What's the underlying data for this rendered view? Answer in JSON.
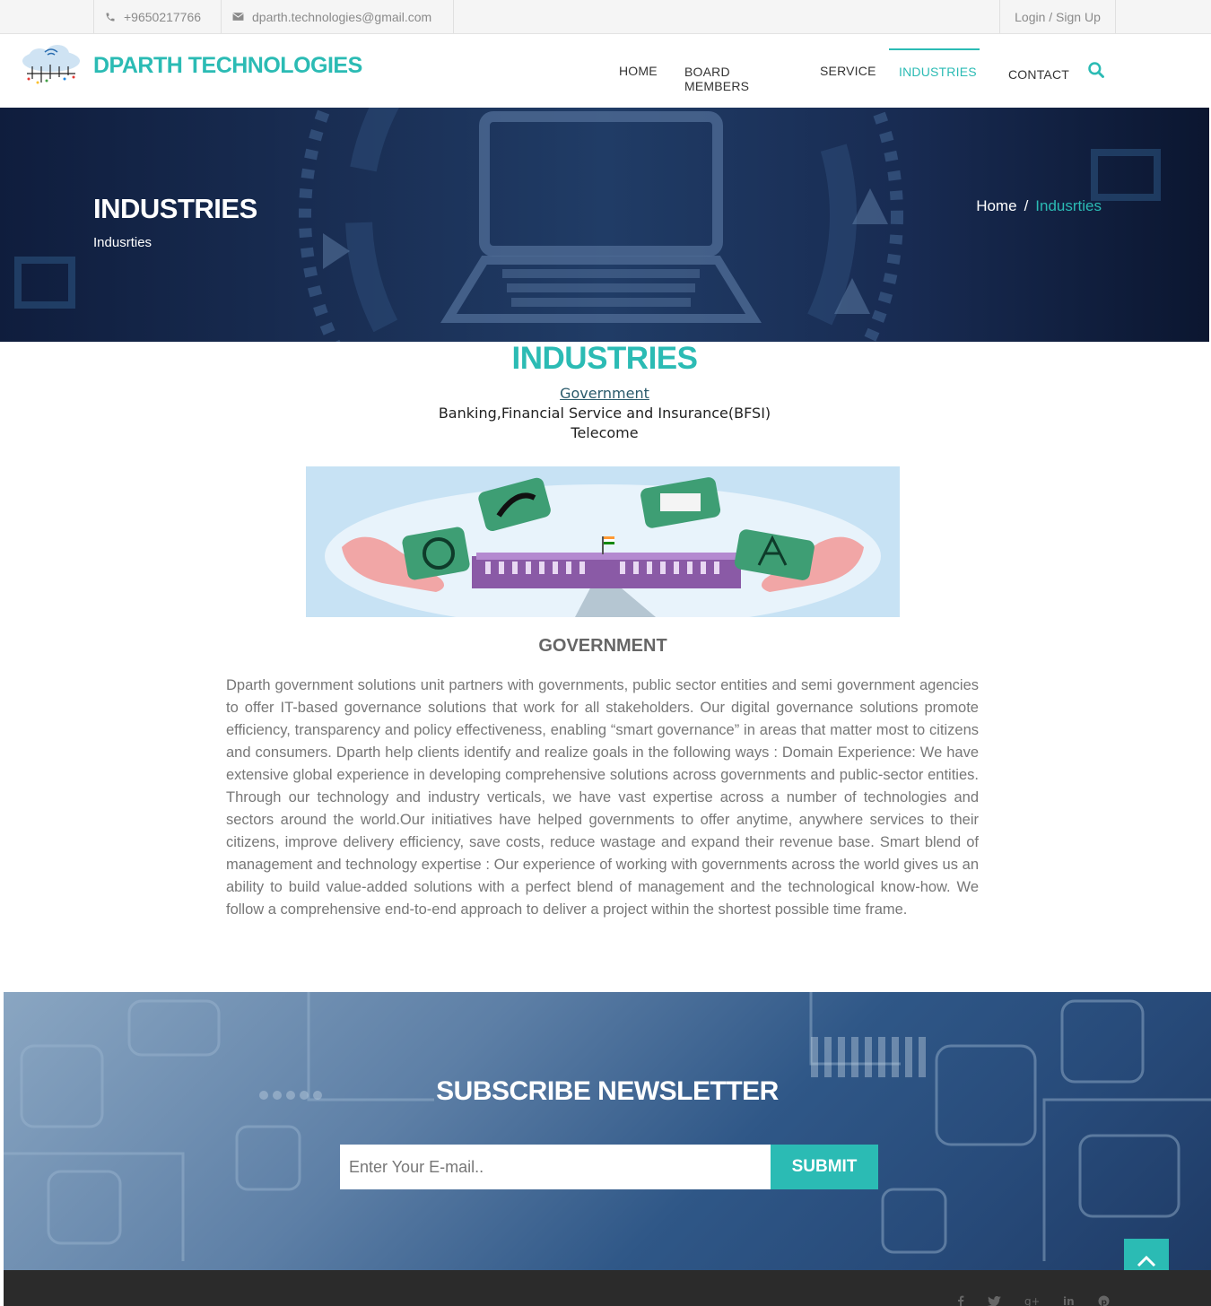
{
  "topbar": {
    "phone": "+9650217766",
    "email": "dparth.technologies@gmail.com",
    "login": "Login / Sign Up"
  },
  "header": {
    "brand": "DPARTH TECHNOLOGIES",
    "nav": [
      "HOME",
      "BOARD MEMBERS",
      "SERVICE",
      "INDUSTRIES",
      "CONTACT"
    ],
    "active_nav": "INDUSTRIES",
    "accent_color": "#2bbbb4"
  },
  "hero": {
    "title": "INDUSTRIES",
    "subtitle": "Indusrties",
    "breadcrumb_home": "Home",
    "breadcrumb_sep": "/",
    "breadcrumb_current": "Indusrties"
  },
  "main": {
    "title": "INDUSTRIES",
    "industries": [
      "Government",
      "Banking,Financial Service and Insurance(BFSI)",
      "Telecome"
    ],
    "gov_heading": "GOVERNMENT",
    "gov_text": "Dparth government solutions unit partners with governments, public sector entities and semi government agencies to offer IT-based governance solutions that work for all stakeholders. Our digital governance solutions promote efficiency, transparency and policy effectiveness, enabling “smart governance” in areas that matter most to citizens and consumers. Dparth help clients identify and realize goals in the following ways : Domain Experience: We have extensive global experience in developing comprehensive solutions across governments and public-sector entities. Through our technology and industry verticals, we have vast expertise across a number of technologies and sectors around the world.Our initiatives have helped governments to offer anytime, anywhere services to their citizens, improve delivery efficiency, save costs, reduce wastage and expand their revenue base. Smart blend of management and technology expertise : Our experience of working with governments across the world gives us an ability to build value-added solutions with a perfect blend of management and the technological know-how. We follow a comprehensive end-to-end approach to deliver a project within the shortest possible time frame."
  },
  "newsletter": {
    "title": "SUBSCRIBE NEWSLETTER",
    "placeholder": "Enter Your E-mail..",
    "submit": "SUBMIT"
  },
  "icons": [
    "phone-icon",
    "mail-icon",
    "search-icon",
    "chevron-up-icon",
    "facebook-icon",
    "twitter-icon",
    "google-plus-icon",
    "linkedin-icon",
    "pinterest-icon"
  ]
}
